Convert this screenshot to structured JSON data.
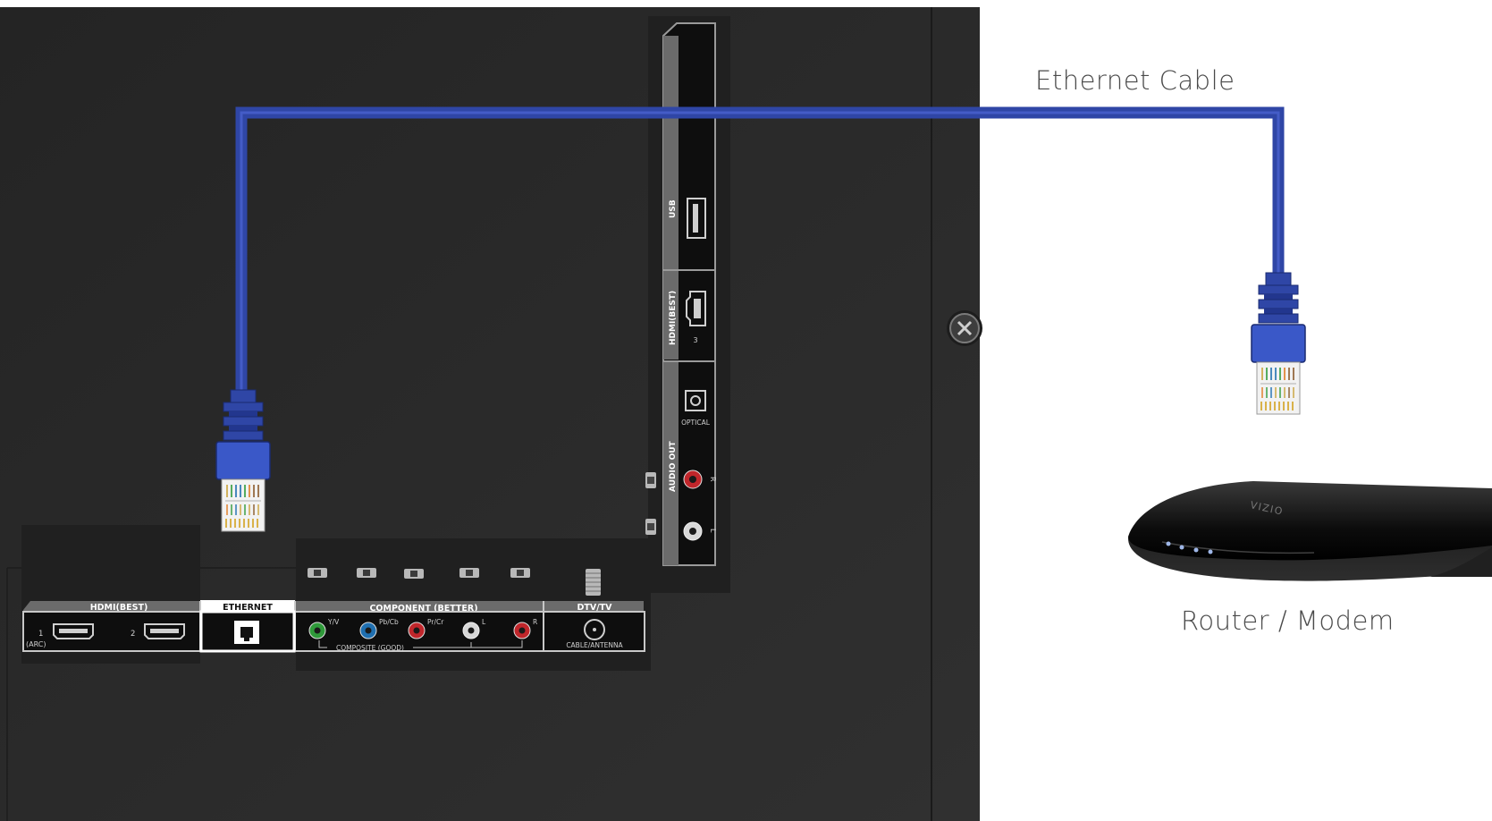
{
  "diagram": {
    "captions": {
      "cable": "Ethernet Cable",
      "router": "Router / Modem"
    },
    "router_brand": "VIZIO",
    "colors": {
      "cable": "#2f46a6",
      "tv_panel": "#2b2b2b",
      "port_label_bg": "#6b6b6b",
      "ethernet_label_bg": "#ffffff",
      "rca_green": "#2f9a3a",
      "rca_blue": "#1f6fb0",
      "rca_red": "#c0262b",
      "rca_white": "#d8d8d8"
    },
    "bottom_ports": {
      "hdmi_header": "HDMI(BEST)",
      "hdmi1": "1",
      "hdmi1_arc": "(ARC)",
      "hdmi2": "2",
      "ethernet_header": "ETHERNET",
      "component_header": "COMPONENT (BETTER)",
      "y_v": "Y/V",
      "pb_cb": "Pb/Cb",
      "pr_cr": "Pr/Cr",
      "audio_l": "L",
      "audio_r": "R",
      "composite": "COMPOSITE (GOOD)",
      "dtv_header": "DTV/TV",
      "antenna": "CABLE/ANTENNA"
    },
    "side_ports": {
      "usb": "USB",
      "hdmi_best": "HDMI(BEST)",
      "hdmi3": "3",
      "optical": "OPTICAL",
      "audio_out": "AUDIO OUT",
      "r": "R",
      "l": "L"
    }
  }
}
